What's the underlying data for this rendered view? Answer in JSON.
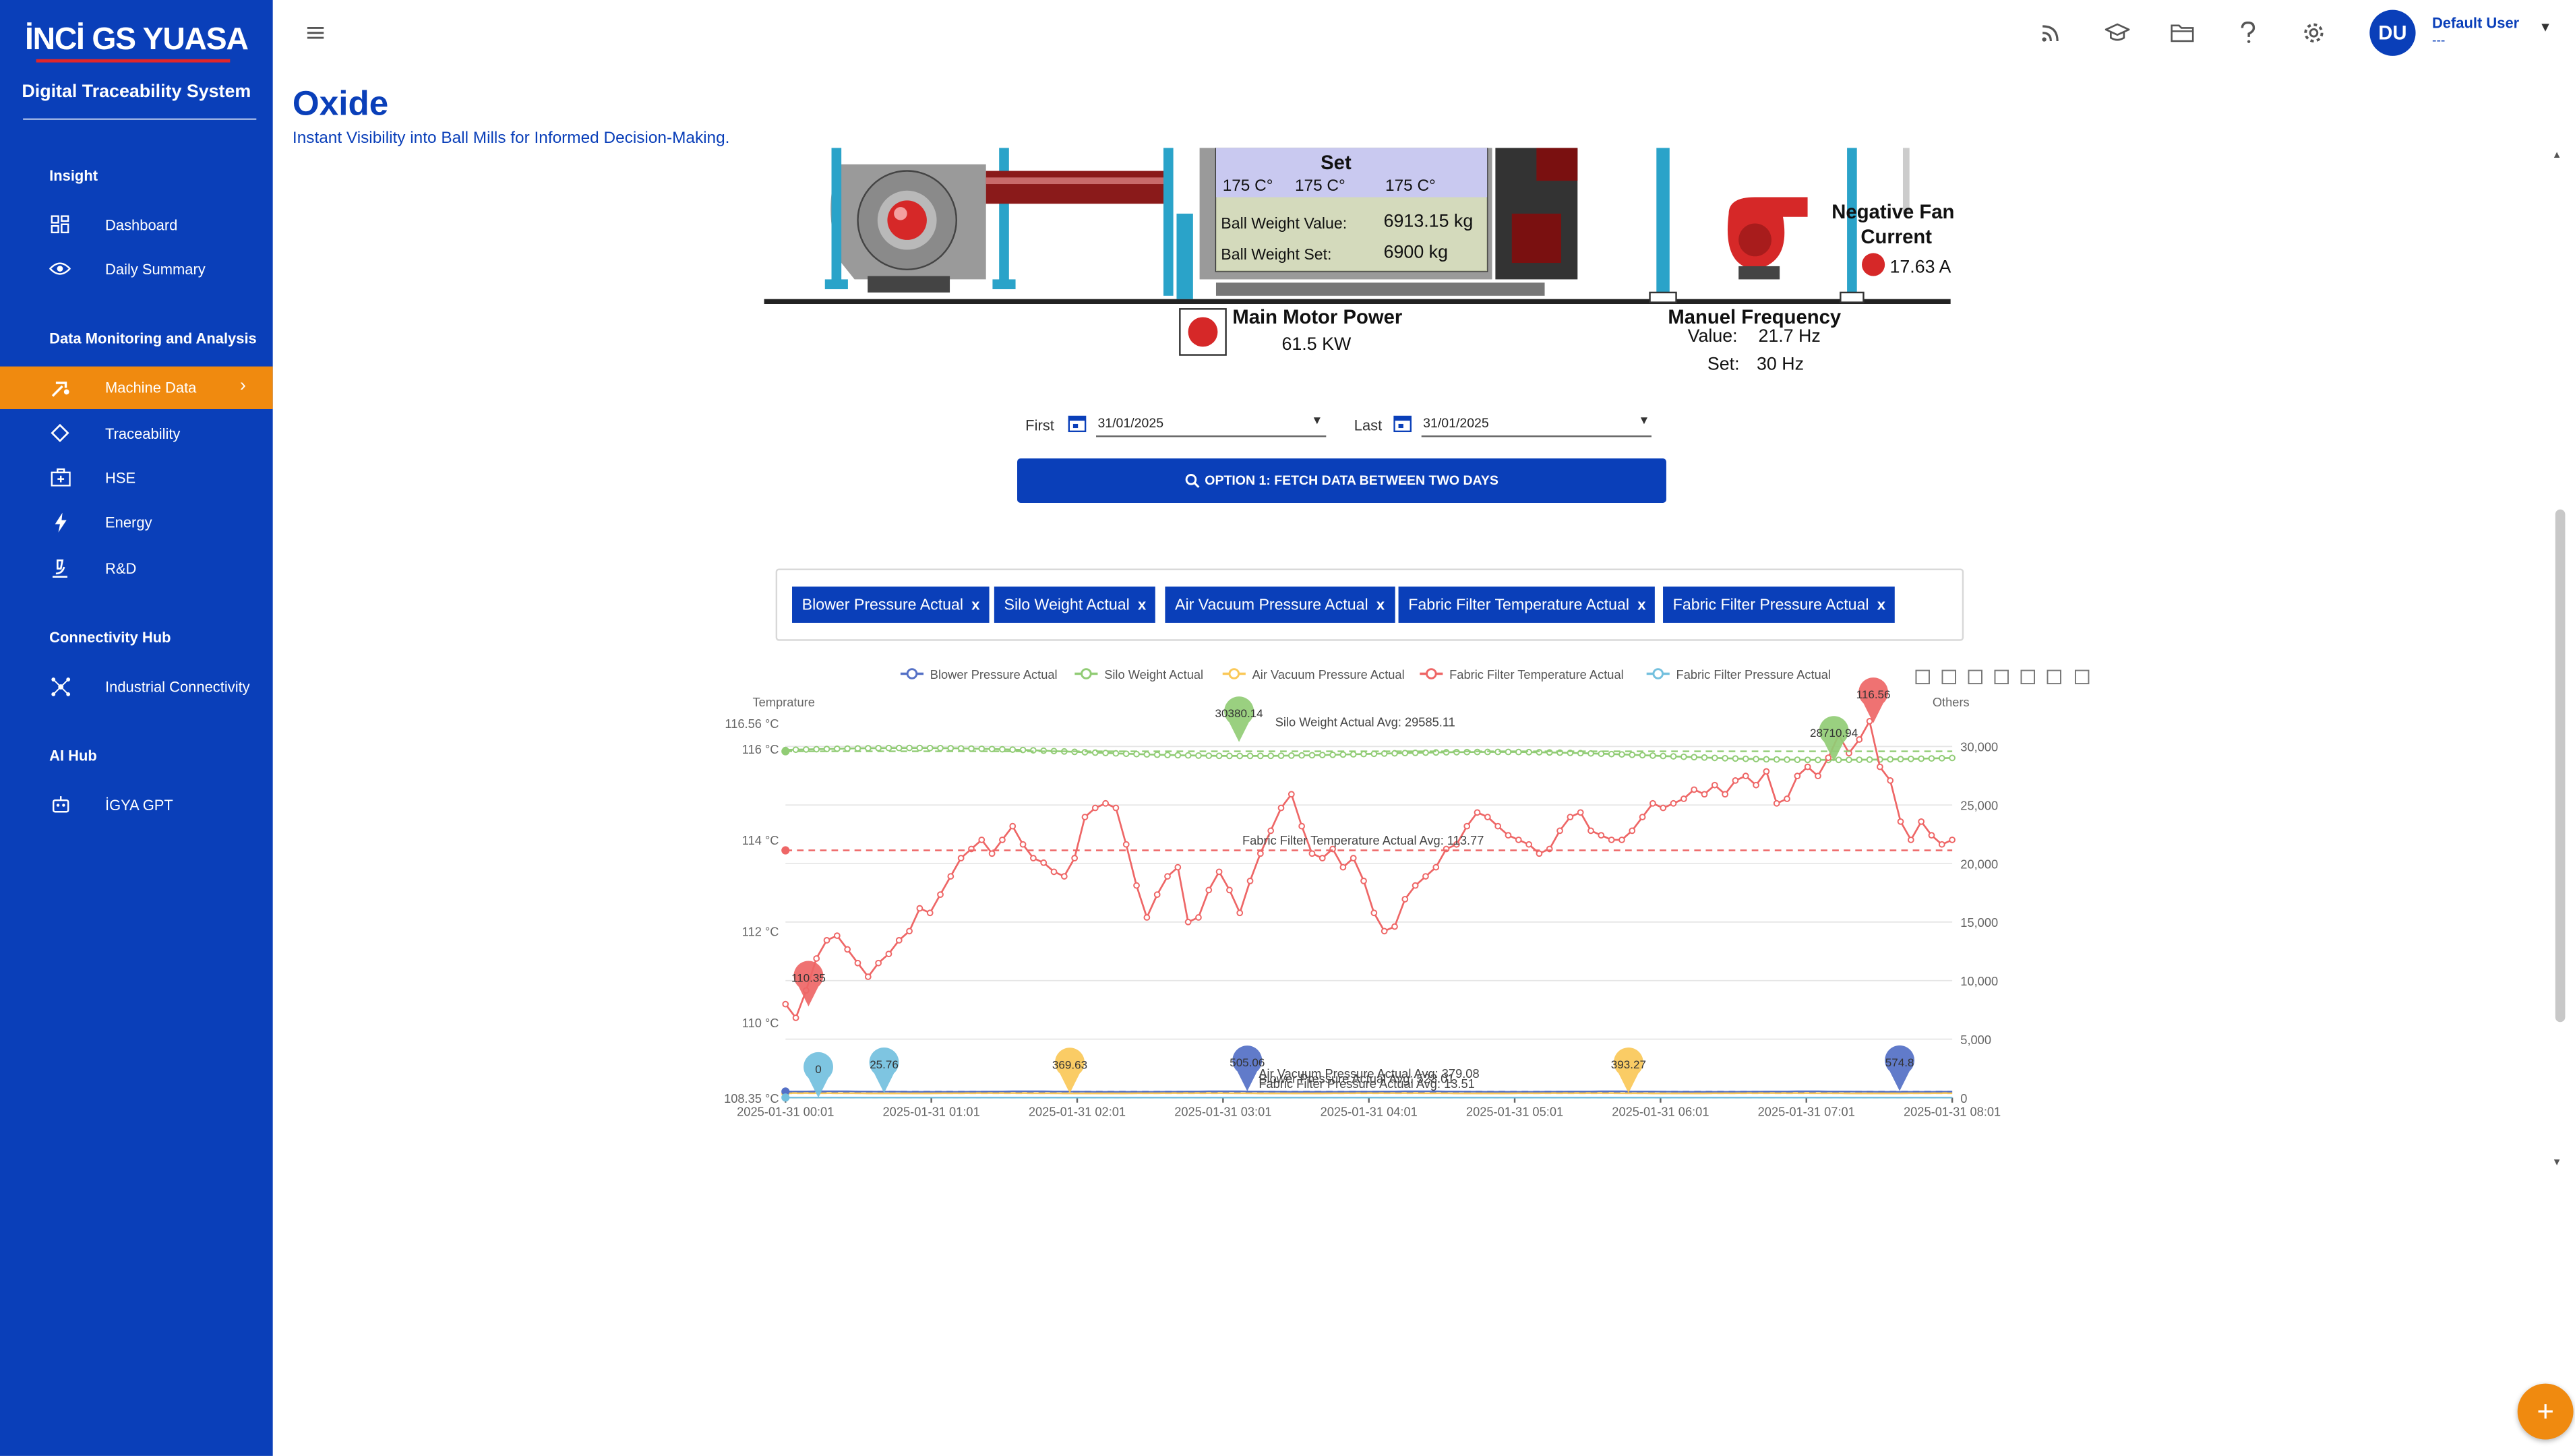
{
  "brand": {
    "logo": "İNCİ GS YUASA",
    "system": "Digital Traceability System"
  },
  "sidebar": {
    "sections": [
      {
        "title": "Insight",
        "items": [
          {
            "label": "Dashboard",
            "icon": "dashboard-icon"
          },
          {
            "label": "Daily Summary",
            "icon": "eye-icon"
          }
        ]
      },
      {
        "title": "Data Monitoring and Analysis",
        "items": [
          {
            "label": "Machine Data",
            "icon": "machine-icon",
            "active": true
          },
          {
            "label": "Traceability",
            "icon": "diamond-icon"
          },
          {
            "label": "HSE",
            "icon": "medkit-icon"
          },
          {
            "label": "Energy",
            "icon": "bolt-icon"
          },
          {
            "label": "R&D",
            "icon": "microscope-icon"
          }
        ]
      },
      {
        "title": "Connectivity Hub",
        "items": [
          {
            "label": "Industrial Connectivity",
            "icon": "network-icon"
          }
        ]
      },
      {
        "title": "AI Hub",
        "items": [
          {
            "label": "İGYA GPT",
            "icon": "robot-icon"
          }
        ]
      }
    ]
  },
  "topbar": {
    "icons": [
      "rss-icon",
      "graduation-cap-icon",
      "folder-icon",
      "help-icon",
      "settings-icon"
    ],
    "user": {
      "initials": "DU",
      "name": "Default User",
      "role": "---"
    }
  },
  "page": {
    "title": "Oxide",
    "subtitle": "Instant Visibility into Ball Mills for Informed Decision-Making."
  },
  "diagram": {
    "set_label": "Set",
    "temps": [
      "175 C°",
      "175 C°",
      "175 C°"
    ],
    "ball_weight_value_label": "Ball Weight Value:",
    "ball_weight_value": "6913.15 kg",
    "ball_weight_set_label": "Ball Weight Set:",
    "ball_weight_set": "6900 kg",
    "main_motor_label": "Main Motor Power",
    "main_motor_value": "61.5 KW",
    "neg_fan_label_1": "Negative Fan",
    "neg_fan_label_2": "Current",
    "neg_fan_value": "17.63 A",
    "manuel_freq_label": "Manuel Frequency",
    "freq_value_label": "Value:",
    "freq_value": "21.7 Hz",
    "freq_set_label": "Set:",
    "freq_set": "30 Hz"
  },
  "filters": {
    "first_label": "First",
    "first_date": "31/01/2025",
    "last_label": "Last",
    "last_date": "31/01/2025",
    "fetch_button": "OPTION 1: FETCH DATA BETWEEN TWO DAYS"
  },
  "chips": [
    "Blower Pressure Actual",
    "Silo Weight Actual",
    "Air Vacuum Pressure Actual",
    "Fabric Filter Temperature Actual",
    "Fabric Filter Pressure Actual"
  ],
  "chart_data": {
    "type": "line",
    "legend": [
      {
        "name": "Blower Pressure Actual",
        "color": "#5470c6"
      },
      {
        "name": "Silo Weight Actual",
        "color": "#91cc75"
      },
      {
        "name": "Air Vacuum Pressure Actual",
        "color": "#fac858"
      },
      {
        "name": "Fabric Filter Temperature Actual",
        "color": "#ee6666"
      },
      {
        "name": "Fabric Filter Pressure Actual",
        "color": "#73c0de"
      }
    ],
    "legend_position": "top-center",
    "toolbox_icons": [
      "zoom-icon",
      "zoom-reset-icon",
      "data-view-icon",
      "line-type-icon",
      "bar-type-icon",
      "restore-icon",
      "download-icon"
    ],
    "y_left": {
      "label": "Temprature",
      "ticks": [
        "110 °C",
        "112 °C",
        "114 °C",
        "116 °C"
      ],
      "top_label": "116.56 °C",
      "bottom_label": "108.35 °C",
      "range": [
        108.35,
        116.56
      ]
    },
    "y_right": {
      "label": "Others",
      "ticks": [
        "0",
        "5,000",
        "10,000",
        "15,000",
        "20,000",
        "25,000",
        "30,000"
      ],
      "range": [
        0,
        32000
      ]
    },
    "x_ticks": [
      "2025-01-31 00:01",
      "2025-01-31 01:01",
      "2025-01-31 02:01",
      "2025-01-31 03:01",
      "2025-01-31 04:01",
      "2025-01-31 05:01",
      "2025-01-31 06:01",
      "2025-01-31 07:01",
      "2025-01-31 08:01"
    ],
    "fabric_filter_temperature": [
      110.4,
      110.1,
      110.7,
      111.4,
      111.8,
      111.9,
      111.6,
      111.3,
      111.0,
      111.3,
      111.5,
      111.8,
      112.0,
      112.5,
      112.4,
      112.8,
      113.2,
      113.6,
      113.8,
      114.0,
      113.7,
      114.0,
      114.3,
      113.9,
      113.6,
      113.5,
      113.3,
      113.2,
      113.6,
      114.5,
      114.7,
      114.8,
      114.7,
      113.9,
      113.0,
      112.3,
      112.8,
      113.2,
      113.4,
      112.2,
      112.3,
      112.9,
      113.3,
      112.9,
      112.4,
      113.1,
      113.7,
      114.2,
      114.7,
      115.0,
      114.3,
      113.7,
      113.6,
      113.8,
      113.4,
      113.6,
      113.1,
      112.4,
      112.0,
      112.1,
      112.7,
      113.0,
      113.2,
      113.4,
      113.8,
      113.9,
      114.3,
      114.6,
      114.5,
      114.3,
      114.1,
      114.0,
      113.9,
      113.7,
      113.8,
      114.2,
      114.5,
      114.6,
      114.2,
      114.1,
      114.0,
      114.0,
      114.2,
      114.5,
      114.8,
      114.7,
      114.8,
      114.9,
      115.1,
      115.0,
      115.2,
      115.0,
      115.3,
      115.4,
      115.2,
      115.5,
      114.8,
      114.9,
      115.4,
      115.6,
      115.4,
      115.8,
      116.3,
      115.9,
      116.2,
      116.6,
      115.6,
      115.3,
      114.4,
      114.0,
      114.4,
      114.1,
      113.9,
      114.0
    ],
    "markers": [
      {
        "series": "Fabric Filter Temperature Actual",
        "label": "110.35",
        "type": "min"
      },
      {
        "series": "Fabric Filter Temperature Actual",
        "label": "116.56",
        "type": "max"
      },
      {
        "series": "Silo Weight Actual",
        "label": "30380.14",
        "type": "max"
      },
      {
        "series": "Silo Weight Actual",
        "label": "28710.94",
        "type": "min"
      },
      {
        "series": "Fabric Filter Pressure Actual",
        "label": "0",
        "type": "min"
      },
      {
        "series": "Fabric Filter Pressure Actual",
        "label": "25.76",
        "type": "max"
      },
      {
        "series": "Air Vacuum Pressure Actual",
        "label": "369.63",
        "type": "min"
      },
      {
        "series": "Air Vacuum Pressure Actual",
        "label": "393.27",
        "type": "max"
      },
      {
        "series": "Blower Pressure Actual",
        "label": "505.06",
        "type": "min"
      },
      {
        "series": "Blower Pressure Actual",
        "label": "574.8",
        "type": "max"
      }
    ],
    "avg_lines": [
      {
        "series": "Silo Weight Actual",
        "label": "Silo Weight Actual Avg: 29585.11",
        "value": 29585.11
      },
      {
        "series": "Fabric Filter Temperature Actual",
        "label": "Fabric Filter Temperature Actual Avg: 113.77",
        "value": 113.77
      },
      {
        "series": "Air Vacuum Pressure Actual",
        "label": "Air Vacuum Pressure Actual Avg: 379.08",
        "value": 379.08
      },
      {
        "series": "Blower Pressure Actual",
        "label": "Blower Pressure Actual Avg: 523.01",
        "value": 523.01
      },
      {
        "series": "Fabric Filter Pressure Actual",
        "label": "Fabric Filter Pressure Actual Avg: 13.51",
        "value": 13.51
      }
    ],
    "silo_weight": 29700
  }
}
